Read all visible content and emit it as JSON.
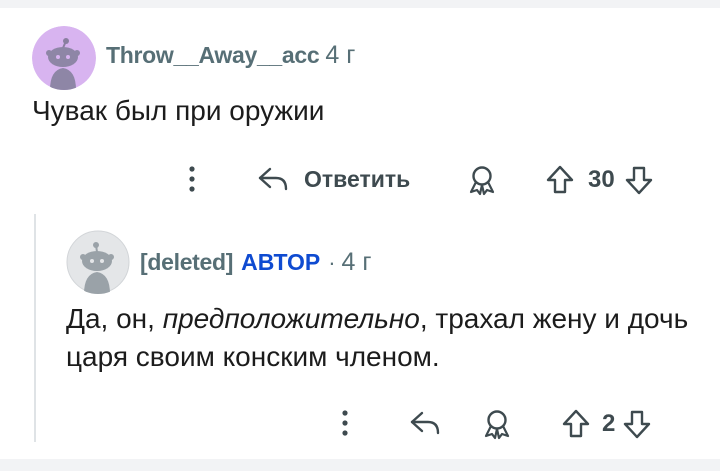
{
  "comments": [
    {
      "username": "Throw__Away__acc",
      "age": "4 г",
      "body": "Чувак был при оружии",
      "avatar_color": "#d8b4f0",
      "actions": {
        "reply_label": "Ответить",
        "score": "30"
      }
    },
    {
      "username": "[deleted]",
      "author_tag": "АВТОР",
      "separator": "·",
      "age": "4 г",
      "body_before": "Да, он, ",
      "body_italic": "предположительно",
      "body_after": ", трахал жену и дочь царя своим конским членом.",
      "avatar_color": "#e4e6e8",
      "actions": {
        "score": "2"
      }
    }
  ],
  "colors": {
    "meta": "#576f76",
    "author": "#0f4bd1",
    "text": "#1c1c1c",
    "icon": "#3e4a4f"
  },
  "icons": [
    "more-vertical-icon",
    "reply-icon",
    "award-icon",
    "upvote-icon",
    "downvote-icon"
  ]
}
